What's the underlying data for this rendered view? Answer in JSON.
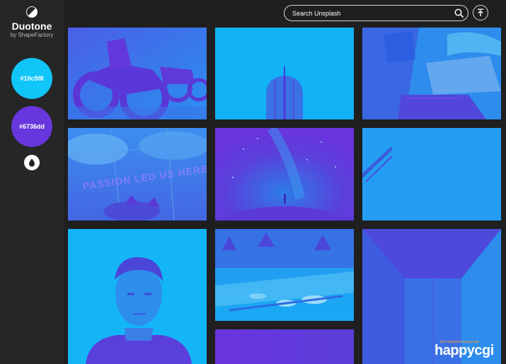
{
  "app": {
    "title": "Duotone",
    "subtitle": "by ShapeFactory"
  },
  "colors": {
    "light": "#10c5f8",
    "dark": "#6736dd",
    "background": "#1f1f1f",
    "sidebar": "#262626"
  },
  "swatches": {
    "light_label": "#10c5f8",
    "dark_label": "#6736dd"
  },
  "search": {
    "placeholder": "Search Unsplash"
  },
  "icons": {
    "logo": "half-circle-icon",
    "drop": "water-drop-icon",
    "search": "search-icon",
    "scroll_top": "arrow-up-to-line-icon"
  },
  "photos": [
    {
      "name": "motorcycles"
    },
    {
      "name": "cactus"
    },
    {
      "name": "laptop-workspace"
    },
    {
      "name": "passion-sign",
      "text": "PASSION LED US HERE"
    },
    {
      "name": "starry-sky"
    },
    {
      "name": "pencil-on-paper"
    },
    {
      "name": "portrait-man"
    },
    {
      "name": "dinner-table"
    },
    {
      "name": "hallway"
    },
    {
      "name": "partial-photo"
    }
  ],
  "watermark": {
    "small": "best programming group",
    "big": "happycgi"
  }
}
